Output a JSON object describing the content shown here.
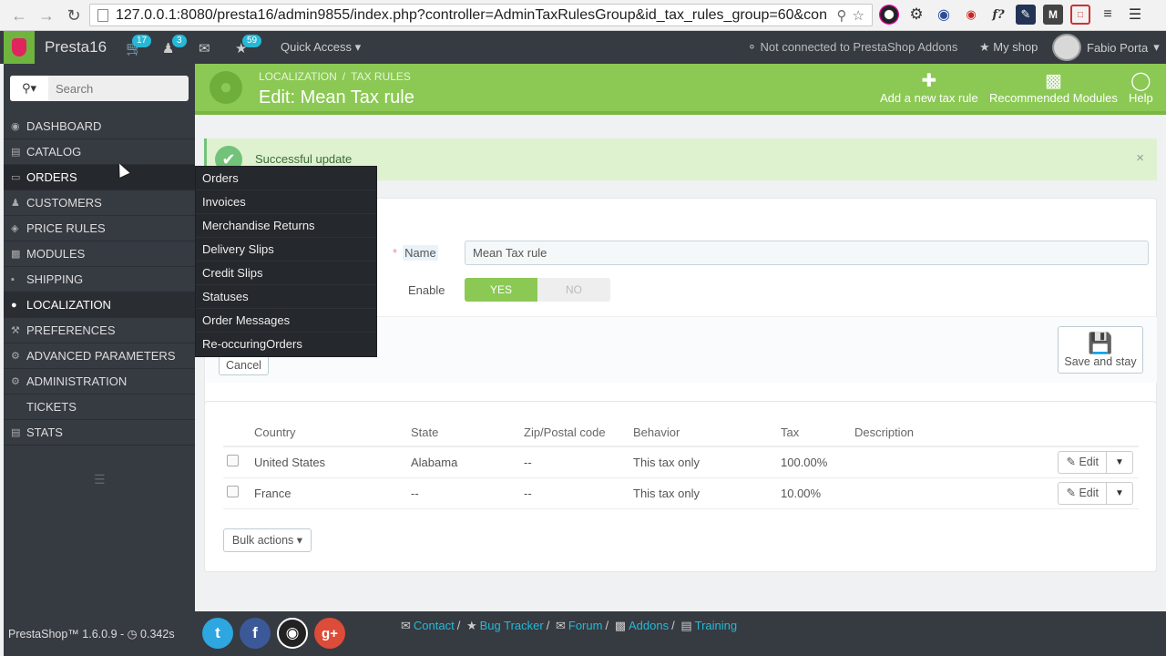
{
  "browser": {
    "url": "127.0.0.1:8080/presta16/admin9855/index.php?controller=AdminTaxRulesGroup&id_tax_rules_group=60&conf="
  },
  "header": {
    "brand": "Presta16",
    "orders_count": "17",
    "customers_count": "3",
    "notifications_count": "59",
    "quick_access": "Quick Access",
    "addons_status": "Not connected to PrestaShop Addons",
    "my_shop": "My shop",
    "user_name": "Fabio Porta"
  },
  "sidebar": {
    "search_placeholder": "Search",
    "items": [
      {
        "label": "DASHBOARD"
      },
      {
        "label": "CATALOG"
      },
      {
        "label": "ORDERS"
      },
      {
        "label": "CUSTOMERS"
      },
      {
        "label": "PRICE RULES"
      },
      {
        "label": "MODULES"
      },
      {
        "label": "SHIPPING"
      },
      {
        "label": "LOCALIZATION"
      },
      {
        "label": "PREFERENCES"
      },
      {
        "label": "ADVANCED PARAMETERS"
      },
      {
        "label": "ADMINISTRATION"
      },
      {
        "label": "TICKETS"
      },
      {
        "label": "STATS"
      }
    ],
    "version": "PrestaShop™ 1.6.0.9 -",
    "load_time": "0.342s"
  },
  "orders_submenu": [
    {
      "label": "Orders"
    },
    {
      "label": "Invoices"
    },
    {
      "label": "Merchandise Returns"
    },
    {
      "label": "Delivery Slips"
    },
    {
      "label": "Credit Slips"
    },
    {
      "label": "Statuses"
    },
    {
      "label": "Order Messages"
    },
    {
      "label": "Re-occuringOrders"
    }
  ],
  "page_head": {
    "breadcrumb_1": "LOCALIZATION",
    "breadcrumb_sep": "/",
    "breadcrumb_2": "TAX RULES",
    "title": "Edit: Mean Tax rule",
    "toolbar": {
      "add": "Add a new tax rule",
      "modules": "Recommended Modules",
      "help": "Help"
    }
  },
  "alert": {
    "message": "Successful update"
  },
  "form": {
    "required_mark": "*",
    "name_label": "Name",
    "name_value": "Mean Tax rule",
    "enable_label": "Enable",
    "yes": "YES",
    "no": "NO",
    "cancel": "Cancel",
    "save_and_stay": "Save and stay"
  },
  "rules_table": {
    "columns": [
      "Country",
      "State",
      "Zip/Postal code",
      "Behavior",
      "Tax",
      "Description"
    ],
    "rows": [
      {
        "country": "United States",
        "state": "Alabama",
        "zip": "--",
        "behavior": "This tax only",
        "tax": "100.00%",
        "description": ""
      },
      {
        "country": "France",
        "state": "--",
        "zip": "--",
        "behavior": "This tax only",
        "tax": "10.00%",
        "description": ""
      }
    ],
    "edit_label": "Edit",
    "bulk_actions": "Bulk actions"
  },
  "footer": {
    "links": [
      "Contact",
      "Bug Tracker",
      "Forum",
      "Addons",
      "Training"
    ],
    "separator": "/"
  },
  "colors": {
    "green": "#8bc954",
    "dark": "#363a41",
    "link": "#25b9d7"
  }
}
